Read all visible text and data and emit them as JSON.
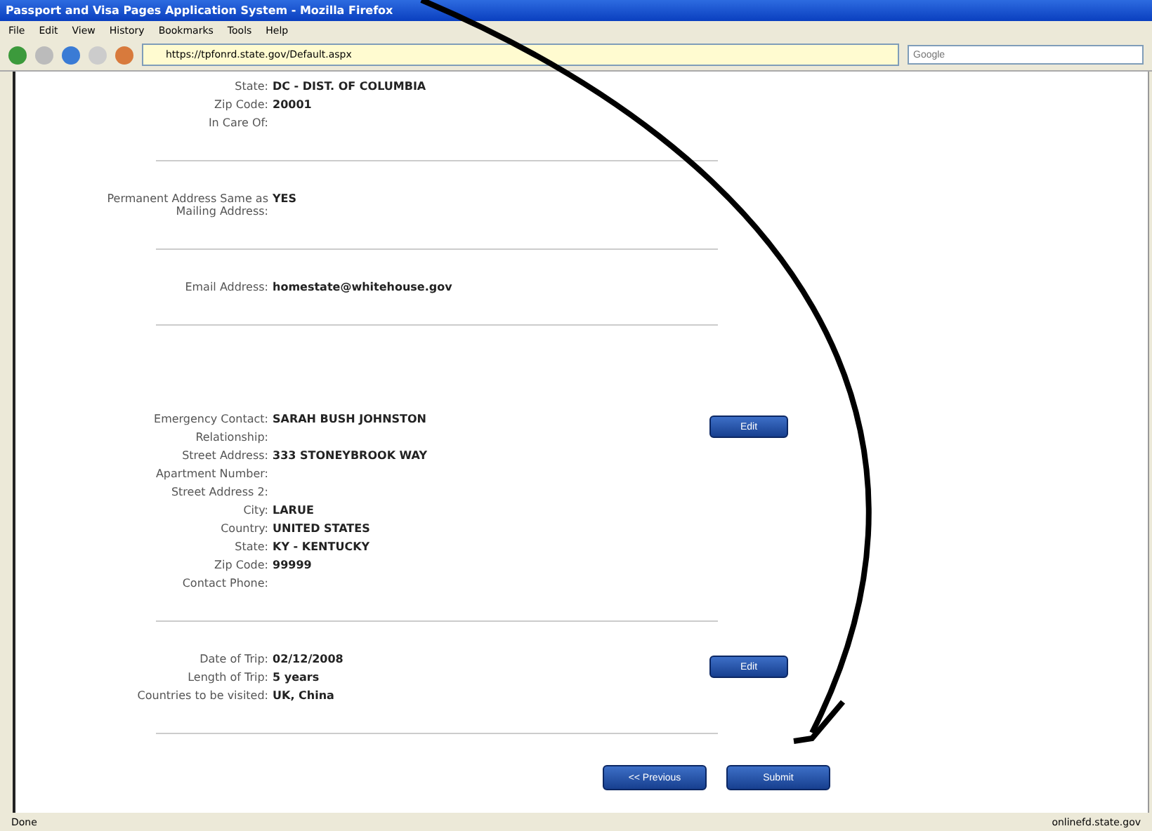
{
  "window": {
    "title": "Passport and Visa Pages Application System - Mozilla Firefox"
  },
  "menu": [
    "File",
    "Edit",
    "View",
    "History",
    "Bookmarks",
    "Tools",
    "Help"
  ],
  "address_bar": {
    "value": "https://tpfonrd.state.gov/Default.aspx"
  },
  "search": {
    "placeholder": "Google"
  },
  "sections": [
    {
      "fields": [
        {
          "label": "State:",
          "value": "DC - DIST. OF COLUMBIA"
        },
        {
          "label": "Zip Code:",
          "value": "20001"
        },
        {
          "label": "In Care Of:"
        }
      ]
    },
    {
      "fields": [
        {
          "label": "Permanent Address Same as Mailing Address:",
          "value": "YES"
        }
      ]
    },
    {
      "fields": [
        {
          "label": "Email Address:",
          "value": "homestate@whitehouse.gov"
        }
      ]
    },
    {
      "edit_button": "Edit",
      "fields": [
        {
          "label": "Emergency Contact:",
          "value": "SARAH BUSH JOHNSTON"
        },
        {
          "label": "Relationship:"
        },
        {
          "label": "Street Address:",
          "value": "333 STONEYBROOK WAY"
        },
        {
          "label": "Apartment Number:"
        },
        {
          "label": "Street Address 2:"
        },
        {
          "label": "City:",
          "value": "LARUE"
        },
        {
          "label": "Country:",
          "value": "UNITED STATES"
        },
        {
          "label": "State:",
          "value": "KY - KENTUCKY"
        },
        {
          "label": "Zip Code:",
          "value": "99999"
        },
        {
          "label": "Contact Phone:"
        }
      ]
    },
    {
      "edit_button": "Edit",
      "fields": [
        {
          "label": "Date of Trip:",
          "value": "02/12/2008"
        },
        {
          "label": "Length of Trip:",
          "value": "5 years"
        },
        {
          "label": "Countries to be visited:",
          "value": "UK, China"
        }
      ]
    }
  ],
  "buttons": [
    "<< Previous",
    "Submit"
  ],
  "status_bar": {
    "left": "Done",
    "right": "onlinefd.state.gov"
  }
}
